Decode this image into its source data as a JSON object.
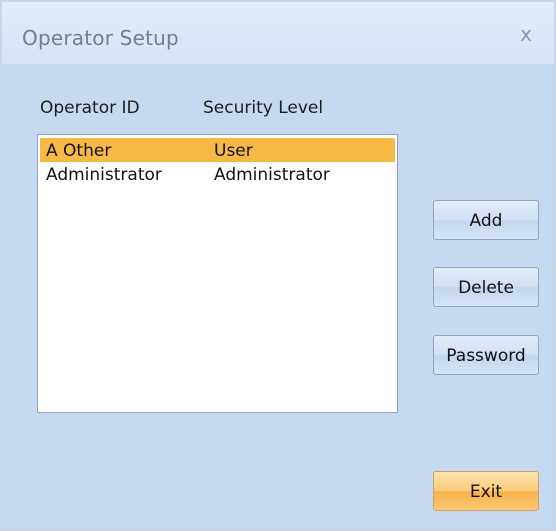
{
  "window": {
    "title": "Operator Setup",
    "close_glyph": "x"
  },
  "columns": {
    "operator_id": "Operator ID",
    "security_level": "Security Level"
  },
  "operators": [
    {
      "id": "A Other",
      "level": "User",
      "selected": true
    },
    {
      "id": "Administrator",
      "level": "Administrator",
      "selected": false
    }
  ],
  "buttons": {
    "add": "Add",
    "delete": "Delete",
    "password": "Password",
    "exit": "Exit"
  },
  "colors": {
    "selection": "#f7b946",
    "window_bg": "#c7d9f1",
    "exit_accent": "#f8b24c"
  }
}
